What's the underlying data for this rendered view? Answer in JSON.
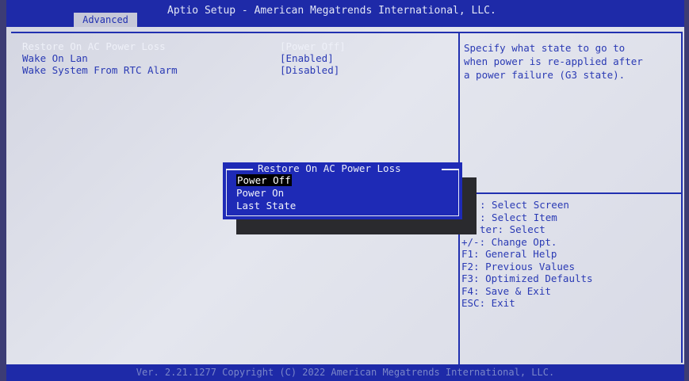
{
  "header": {
    "title": "Aptio Setup - American Megatrends International, LLC.",
    "tab": "Advanced"
  },
  "settings": [
    {
      "label": "Restore On AC Power Loss",
      "value": "[Power Off]"
    },
    {
      "label": "Wake On Lan",
      "value": "[Enabled]"
    },
    {
      "label": "Wake System From RTC Alarm",
      "value": "[Disabled]"
    }
  ],
  "help": {
    "line1": "Specify what state to go to",
    "line2": "when power is re-applied after",
    "line3": "a power failure (G3 state)."
  },
  "keys": [
    ": Select Screen",
    ": Select Item",
    "ter: Select",
    "+/-: Change Opt.",
    "F1: General Help",
    "F2: Previous Values",
    "F3: Optimized Defaults",
    "F4: Save & Exit",
    "ESC: Exit"
  ],
  "popup": {
    "title": "Restore On AC Power Loss",
    "options": [
      "Power Off",
      "Power On",
      "Last State"
    ],
    "selected": "Power Off"
  },
  "footer": "Ver. 2.21.1277 Copyright (C) 2022 American Megatrends International, LLC."
}
